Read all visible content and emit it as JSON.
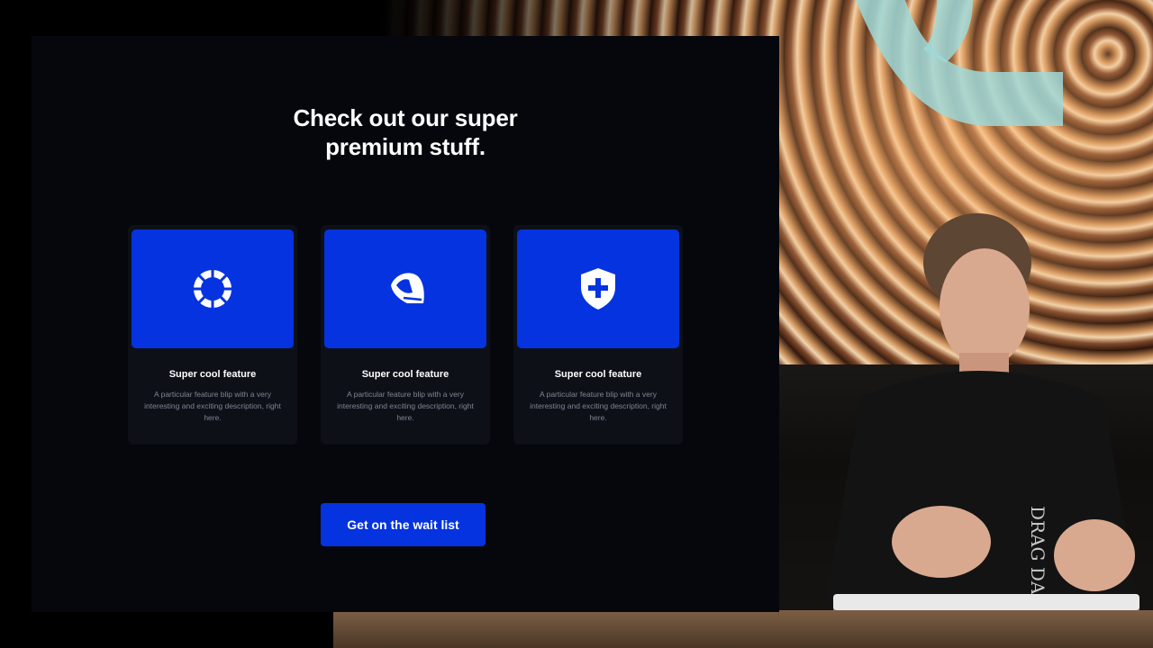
{
  "slide": {
    "headline_line1": "Check out our super",
    "headline_line2": "premium stuff.",
    "cards": [
      {
        "icon": "ring-icon",
        "title": "Super cool feature",
        "description": "A particular feature blip with a very interesting and exciting description, right here."
      },
      {
        "icon": "helmet-icon",
        "title": "Super cool feature",
        "description": "A particular feature blip with a very interesting and exciting description, right here."
      },
      {
        "icon": "shield-plus-icon",
        "title": "Super cool feature",
        "description": "A particular feature blip with a very interesting and exciting description, right here."
      }
    ],
    "cta_label": "Get on the wait list"
  },
  "colors": {
    "slide_background": "#05070c",
    "card_background": "#0d1017",
    "accent_blue": "#0533e0",
    "muted_text": "#7f8594"
  },
  "shirt_print": "DRAG DAD"
}
